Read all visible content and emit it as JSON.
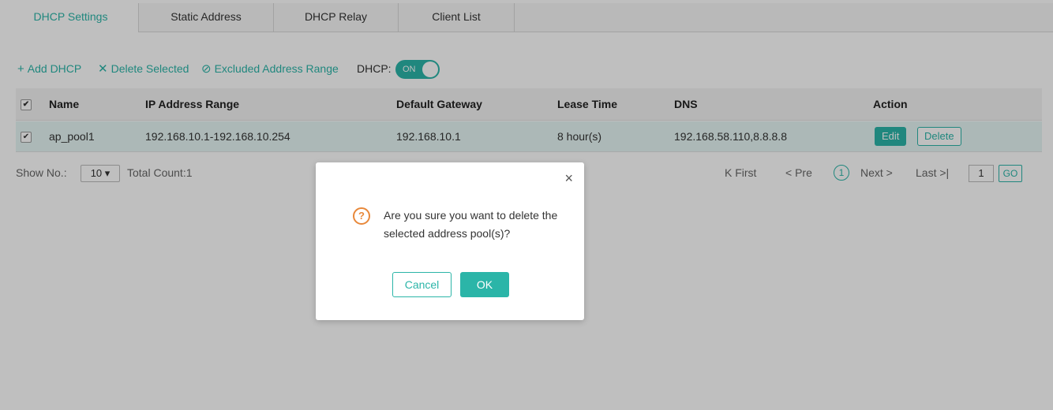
{
  "tabs": [
    {
      "label": "DHCP Settings",
      "active": true
    },
    {
      "label": "Static Address",
      "active": false
    },
    {
      "label": "DHCP Relay",
      "active": false
    },
    {
      "label": "Client List",
      "active": false
    }
  ],
  "toolbar": {
    "add": {
      "icon": "+",
      "label": "Add DHCP"
    },
    "delete_selected": {
      "icon": "✕",
      "label": "Delete Selected"
    },
    "excluded_range": {
      "icon": "⊘",
      "label": "Excluded Address Range"
    },
    "dhcp_label": "DHCP:",
    "dhcp_toggle": "ON"
  },
  "table": {
    "header": {
      "check": "✔",
      "name": "Name",
      "ip_range": "IP Address Range",
      "gateway": "Default Gateway",
      "lease": "Lease Time",
      "dns": "DNS",
      "action": "Action"
    },
    "rows": [
      {
        "check": "✔",
        "name": "ap_pool1",
        "ip_range": "192.168.10.1-192.168.10.254",
        "gateway": "192.168.10.1",
        "lease": "8 hour(s)",
        "dns": "192.168.58.110,8.8.8.8",
        "edit": "Edit",
        "delete": "Delete"
      }
    ]
  },
  "footer": {
    "show_no_label": "Show No.:",
    "show_no_value": "10 ▾",
    "total": "Total Count:1",
    "first": "K First",
    "prev": "< Pre",
    "current": "1",
    "next": "Next >",
    "last": "Last >|",
    "page_input": "1",
    "go": "GO"
  },
  "dialog": {
    "close": "×",
    "icon": "?",
    "message": "Are you sure you want to delete the selected address pool(s)?",
    "cancel": "Cancel",
    "ok": "OK"
  },
  "colors": {
    "accent": "#2bb5a8",
    "warning": "#e8883a",
    "overlay": "rgba(0,0,0,0.25)"
  }
}
